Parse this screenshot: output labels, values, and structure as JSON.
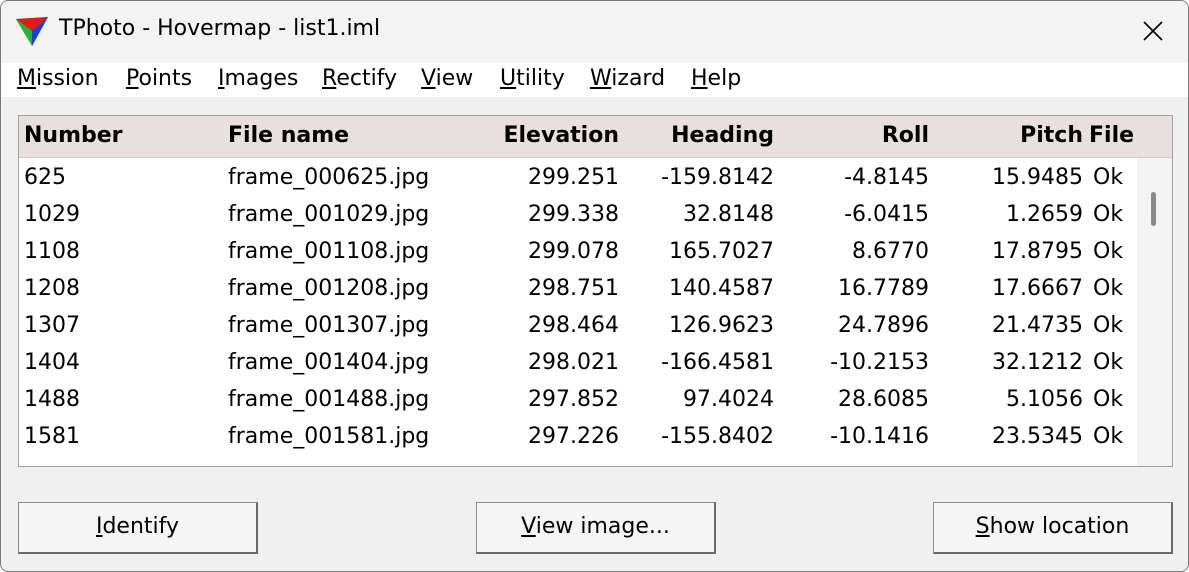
{
  "window": {
    "title": "TPhoto - Hovermap - list1.iml",
    "app_icon": "tphoto-triangle-icon",
    "close_icon": "close-icon"
  },
  "menu": [
    {
      "key": "M",
      "rest": "ission"
    },
    {
      "key": "P",
      "rest": "oints"
    },
    {
      "key": "I",
      "rest": "mages"
    },
    {
      "key": "R",
      "rest": "ectify"
    },
    {
      "key": "V",
      "rest": "iew"
    },
    {
      "key": "U",
      "rest": "tility"
    },
    {
      "key": "W",
      "rest": "izard"
    },
    {
      "key": "H",
      "rest": "elp"
    }
  ],
  "table": {
    "columns": [
      "Number",
      "File name",
      "Elevation",
      "Heading",
      "Roll",
      "Pitch",
      "File"
    ],
    "rows": [
      [
        "625",
        "frame_000625.jpg",
        "299.251",
        "-159.8142",
        "-4.8145",
        "15.9485",
        "Ok"
      ],
      [
        "1029",
        "frame_001029.jpg",
        "299.338",
        "32.8148",
        "-6.0415",
        "1.2659",
        "Ok"
      ],
      [
        "1108",
        "frame_001108.jpg",
        "299.078",
        "165.7027",
        "8.6770",
        "17.8795",
        "Ok"
      ],
      [
        "1208",
        "frame_001208.jpg",
        "298.751",
        "140.4587",
        "16.7789",
        "17.6667",
        "Ok"
      ],
      [
        "1307",
        "frame_001307.jpg",
        "298.464",
        "126.9623",
        "24.7896",
        "21.4735",
        "Ok"
      ],
      [
        "1404",
        "frame_001404.jpg",
        "298.021",
        "-166.4581",
        "-10.2153",
        "32.1212",
        "Ok"
      ],
      [
        "1488",
        "frame_001488.jpg",
        "297.852",
        "97.4024",
        "28.6085",
        "5.1056",
        "Ok"
      ],
      [
        "1581",
        "frame_001581.jpg",
        "297.226",
        "-155.8402",
        "-10.1416",
        "23.5345",
        "Ok"
      ]
    ]
  },
  "buttons": {
    "identify": {
      "key": "I",
      "rest": "dentify"
    },
    "view_image": {
      "key": "V",
      "rest": "iew image..."
    },
    "show_location": {
      "key": "S",
      "rest": "how location"
    }
  },
  "colors": {
    "header_bg": "#e8dfdf",
    "window_bg": "#f0f0f0"
  }
}
